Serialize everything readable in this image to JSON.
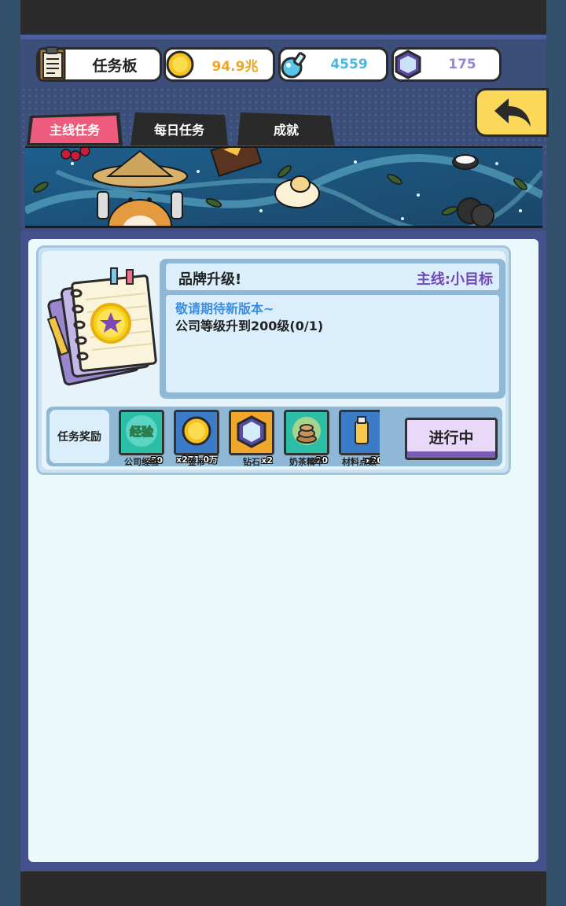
{
  "header": {
    "board_label": "任务板",
    "gold_value": "94.9兆",
    "potion_value": "4559",
    "gem_value": "175"
  },
  "tabs": [
    {
      "label": "主线任务",
      "active": true
    },
    {
      "label": "每日任务",
      "active": false
    },
    {
      "label": "成就",
      "active": false
    }
  ],
  "task": {
    "title": "品牌升级!",
    "type": "主线:小目标",
    "subtitle": "敬请期待新版本~",
    "requirement": "公司等级升到200级(0/1)"
  },
  "rewards": {
    "label": "任务奖励",
    "items": [
      {
        "name": "公司经验",
        "qty": "x50",
        "icon": "exp-icon"
      },
      {
        "name": "金币",
        "qty": "x271.0万",
        "icon": "gold-coin-icon"
      },
      {
        "name": "钻石",
        "qty": "x2",
        "icon": "diamond-icon"
      },
      {
        "name": "奶茶精华",
        "qty": "x20",
        "icon": "milk-tea-essence-icon"
      },
      {
        "name": "材料点数",
        "qty": "x20",
        "icon": "material-points-icon"
      }
    ],
    "exp_badge": "经验"
  },
  "action_button": "进行中",
  "colors": {
    "accent_tab": "#ee5b7d",
    "back_button": "#fbd85a",
    "type_text": "#7248b8",
    "subtitle_text": "#3b8ee0"
  }
}
